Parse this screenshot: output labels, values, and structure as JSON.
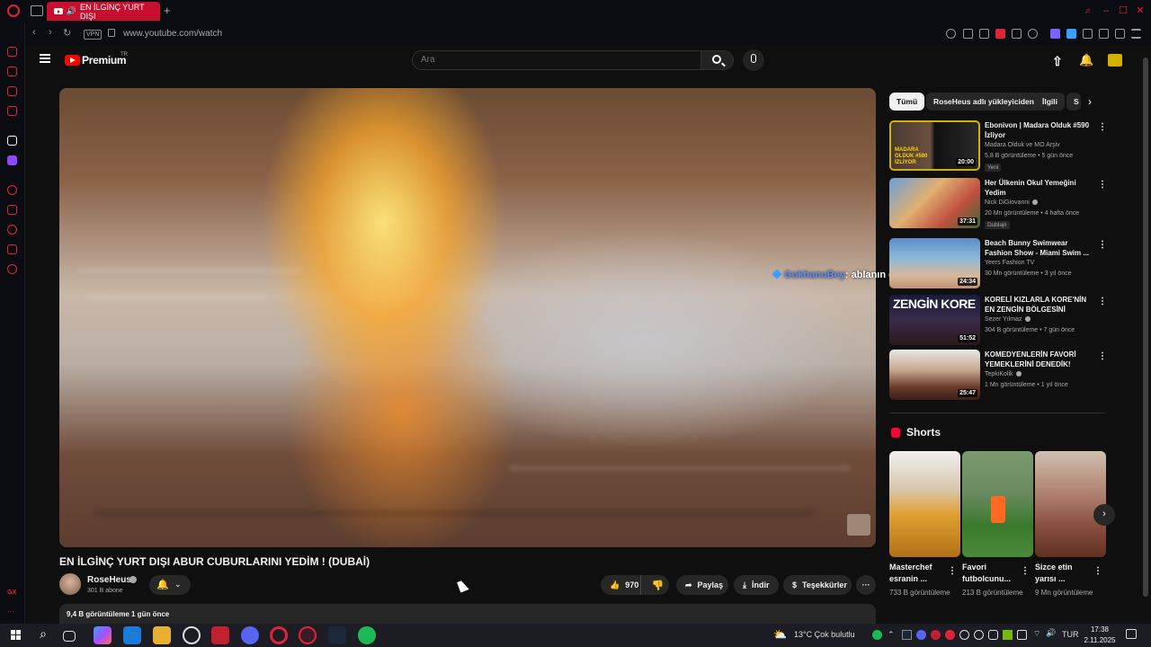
{
  "browser": {
    "tab_title": "EN İLGİNÇ YURT DIŞI",
    "url": "www.youtube.com/watch",
    "vpn_label": "VPN",
    "accent": "#e0233a"
  },
  "youtube": {
    "brand": "Premium",
    "brand_country": "TR",
    "search_placeholder": "Ara",
    "video": {
      "title": "EN İLGİNÇ YURT DIŞI ABUR CUBURLARINI YEDİM ! (DUBAİ)",
      "channel": "RoseHeus",
      "subscribers": "301 B abone",
      "likes": "970",
      "share_label": "Paylaş",
      "download_label": "İndir",
      "thanks_label": "Teşekkürler",
      "views_and_date": "9,4 B görüntüleme  1 gün önce"
    },
    "chat_overlay": {
      "user": "GokhanuBey",
      "message": ": ablanın dile bak"
    },
    "chips": [
      "Tümü",
      "RoseHeus adlı yükleyiciden",
      "İlgili",
      "S"
    ],
    "recommendations": [
      {
        "title": "Ebonivon | Madara Olduk #590 İzliyor",
        "channel": "Madara Olduk ve MO Arşiv",
        "meta": "5,8 B görüntüleme • 5 gün önce",
        "badge": "Yeni",
        "duration": "20:00",
        "thumb_overlay": "MADARA OLDUK #590 İZLİYOR",
        "verified": false
      },
      {
        "title": "Her Ülkenin Okul Yemeğini Yedim",
        "channel": "Nick DiGiovanni",
        "meta": "20 Mn görüntüleme • 4 hafta önce",
        "badge": "Dublajlı",
        "duration": "37:31",
        "thumb_overlay": "",
        "verified": true
      },
      {
        "title": "Beach Bunny Swimwear Fashion Show - Miami Swim ...",
        "channel": "Yeers Fashion TV",
        "meta": "30 Mn görüntüleme • 3 yıl önce",
        "badge": "",
        "duration": "24:34",
        "thumb_overlay": "",
        "verified": false
      },
      {
        "title": "KORELİ KIZLARLA KORE'NİN EN ZENGİN BÖLGESİNİ GEZDİM!",
        "channel": "Sezer Yılmaz",
        "meta": "304 B görüntüleme • 7 gün önce",
        "badge": "",
        "duration": "51:52",
        "thumb_overlay": "ZENGİN KORE",
        "verified": true
      },
      {
        "title": "KOMEDYENLERİN FAVORİ YEMEKLERİNİ DENEDİK!",
        "channel": "TepkiKolik",
        "meta": "1 Mn görüntüleme • 1 yıl önce",
        "badge": "",
        "duration": "25:47",
        "thumb_overlay": "",
        "verified": true
      }
    ],
    "shorts_title": "Shorts",
    "shorts": [
      {
        "title": "Masterchef esranin ...",
        "views": "733 B görüntüleme"
      },
      {
        "title": "Favori futbolcunu...",
        "views": "213 B görüntüleme"
      },
      {
        "title": "Sizce etin yarısı ...",
        "views": "9 Mn görüntüleme"
      }
    ]
  },
  "taskbar": {
    "weather": "13°C  Çok bulutlu",
    "lang": "TUR",
    "time": "17:38",
    "date": "2.11.2025"
  }
}
